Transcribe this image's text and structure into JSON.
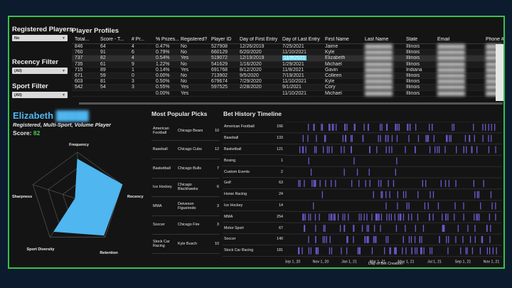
{
  "filters": [
    {
      "title": "Registered Players",
      "value": "No"
    },
    {
      "title": "Recency Filter",
      "value": "(All)"
    },
    {
      "title": "Sport Filter",
      "value": "(All)"
    }
  ],
  "profiles": {
    "title": "Player Profiles",
    "columns": [
      "Total...",
      "Score - T...",
      "# Pr...",
      "% Prizes...",
      "Registered?",
      "Player ID",
      "Day of First Entry",
      "Day of Last Entry",
      "First Name",
      "Last Name",
      "State",
      "Email",
      "Phone #"
    ],
    "rows": [
      [
        "846",
        "64",
        "4",
        "0.47%",
        "No",
        "527908",
        "12/26/2019",
        "7/25/2021",
        "Jaime",
        "",
        "Illinois",
        "",
        ""
      ],
      [
        "760",
        "91",
        "6",
        "0.79%",
        "No",
        "660129",
        "6/20/2020",
        "11/10/2021",
        "Kyle",
        "",
        "Illinois",
        "",
        ""
      ],
      [
        "737",
        "82",
        "4",
        "0.54%",
        "Yes",
        "519072",
        "12/19/2019",
        "11/8/2021",
        "Elizabeth",
        "",
        "Illinois",
        "",
        ""
      ],
      [
        "735",
        "61",
        "9",
        "1.22%",
        "No",
        "541629",
        "1/16/2020",
        "1/29/2021",
        "Michael",
        "",
        "Illinois",
        "",
        ""
      ],
      [
        "715",
        "89",
        "1",
        "0.14%",
        "Yes",
        "691768",
        "8/12/2020",
        "11/8/2021",
        "Gavin",
        "",
        "Indiana",
        "",
        ""
      ],
      [
        "671",
        "59",
        "0",
        "0.00%",
        "No",
        "713902",
        "9/5/2020",
        "7/19/2021",
        "Colleen",
        "",
        "Illinois",
        "",
        ""
      ],
      [
        "603",
        "81",
        "3",
        "0.50%",
        "No",
        "679674",
        "7/29/2020",
        "11/10/2021",
        "Kyle",
        "",
        "Illinois",
        "",
        ""
      ],
      [
        "542",
        "54",
        "3",
        "0.55%",
        "Yes",
        "597525",
        "2/28/2020",
        "9/1/2021",
        "Cory",
        "",
        "Illinois",
        "",
        ""
      ],
      [
        "",
        "",
        "",
        "0.00%",
        "Yes",
        "",
        "",
        "11/10/2021",
        "Michael",
        "",
        "Illinois",
        "",
        ""
      ]
    ]
  },
  "player": {
    "first_name": "Elizabeth",
    "tags": "Registered, Multi-Sport, Volume Player",
    "score_label": "Score:",
    "score": "82",
    "radar_axes": [
      "Frequency",
      "Recency",
      "Retention",
      "Sport Diversity",
      "Sharpness"
    ]
  },
  "picks": {
    "title": "Most Popular Picks",
    "items": [
      {
        "sport": "American Football",
        "pick": "Chicago Bears",
        "count": "10"
      },
      {
        "sport": "Baseball",
        "pick": "Chicago Cubs",
        "count": "12"
      },
      {
        "sport": "Basketball",
        "pick": "Chicago Bulls",
        "count": "7"
      },
      {
        "sport": "Ice Hockey",
        "pick": "Chicago Blackhawks",
        "count": "6"
      },
      {
        "sport": "MMA",
        "pick": "Deiveson Figueiredo",
        "count": "3"
      },
      {
        "sport": "Soccer",
        "pick": "Chicago Fire",
        "count": "3"
      },
      {
        "sport": "Stock Car Racing",
        "pick": "Kyle Busch",
        "count": "10"
      }
    ]
  },
  "timeline": {
    "title": "Bet History Timeline",
    "xlabel": "Day of Bet Creation",
    "ticks": [
      "Sep 1, 20",
      "Nov 1, 20",
      "Jan 1, 21",
      "Mar 1, 21",
      "May 1, 21",
      "Jul 1, 21",
      "Sep 1, 21",
      "Nov 1, 21"
    ],
    "rows": [
      {
        "sport": "American Football",
        "count": "166"
      },
      {
        "sport": "Baseball",
        "count": "133"
      },
      {
        "sport": "Basketball",
        "count": "121"
      },
      {
        "sport": "Boxing",
        "count": "1"
      },
      {
        "sport": "Custom Events",
        "count": "2"
      },
      {
        "sport": "Golf",
        "count": "63"
      },
      {
        "sport": "Horse Racing",
        "count": "24"
      },
      {
        "sport": "Ice Hockey",
        "count": "14"
      },
      {
        "sport": "MMA",
        "count": "254"
      },
      {
        "sport": "Motor Sport",
        "count": "67"
      },
      {
        "sport": "Soccer",
        "count": "140"
      },
      {
        "sport": "Stock Car Racing",
        "count": "181"
      }
    ]
  },
  "colors": {
    "accent": "#4fb6f0",
    "score": "#3ecf52",
    "bar": "#6a5acd",
    "frame": "#36c24a",
    "radar_fill": "#4fb6f0"
  }
}
